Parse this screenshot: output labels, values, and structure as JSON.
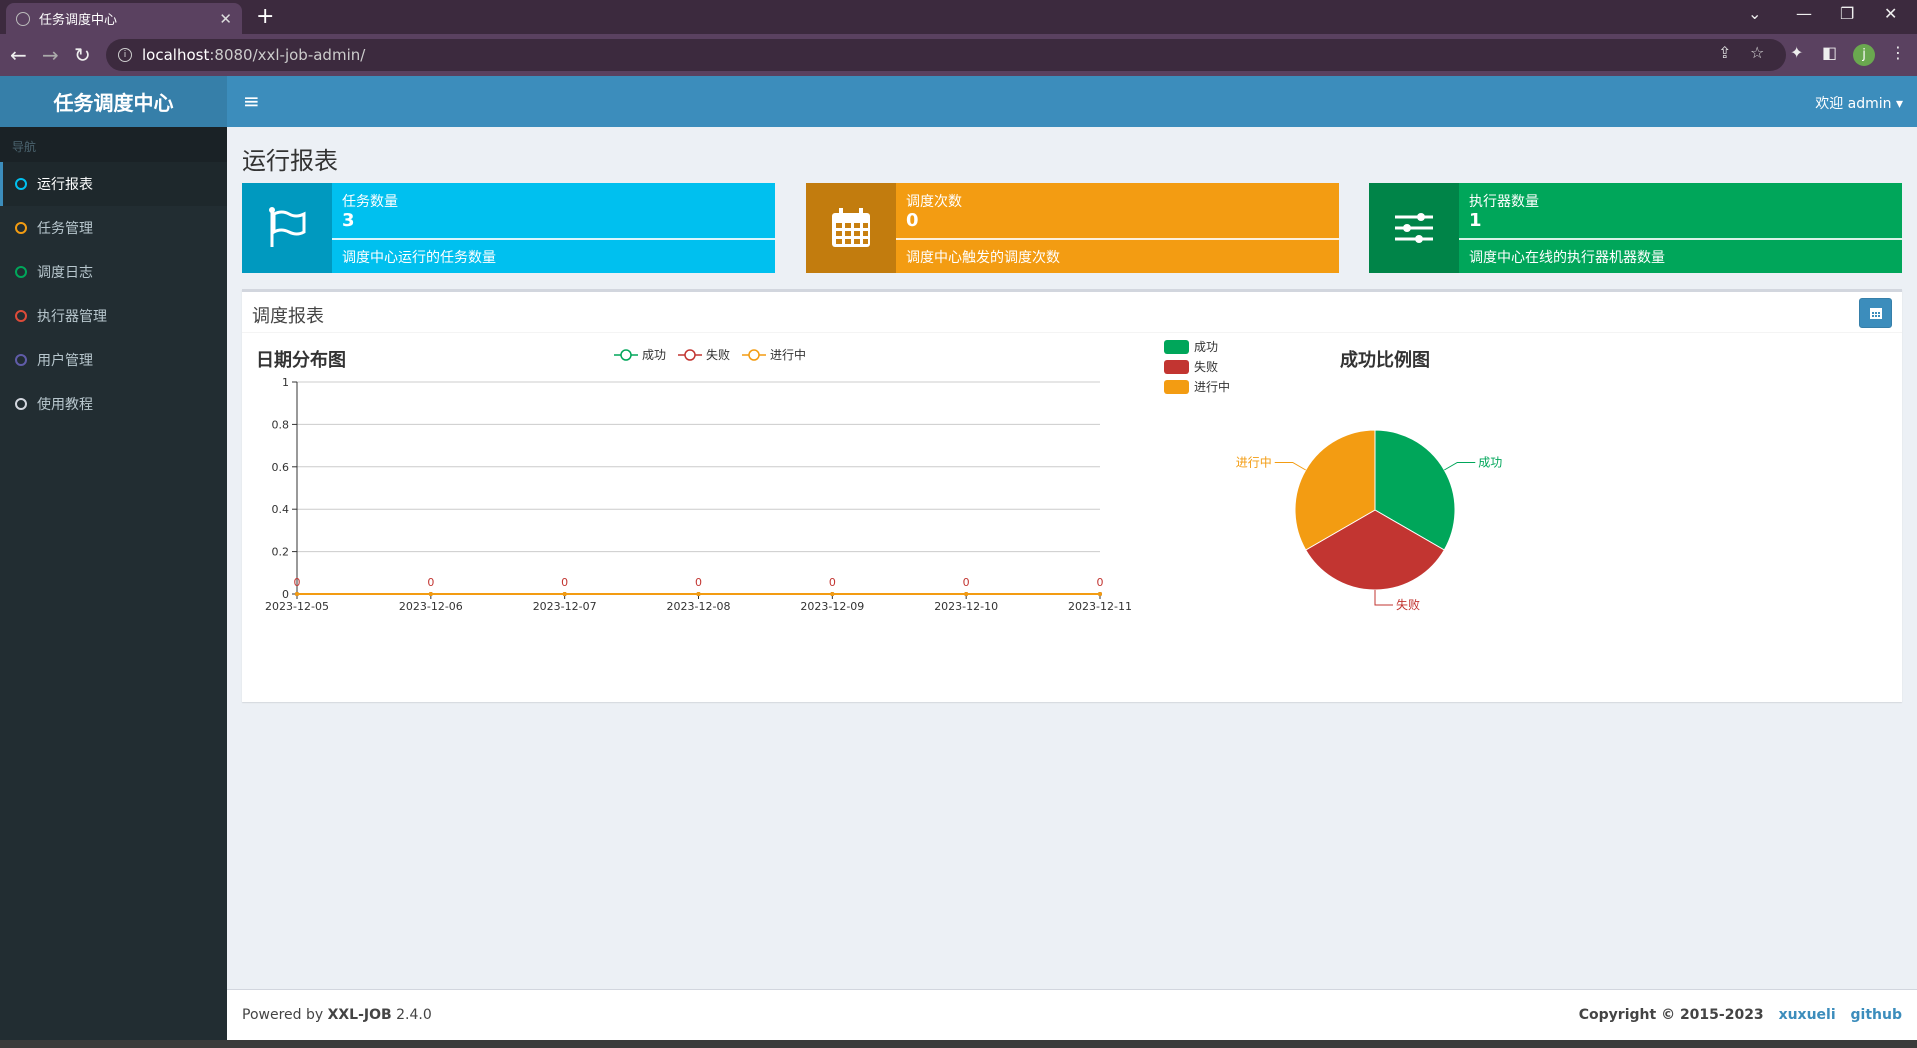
{
  "browser": {
    "tab_title": "任务调度中心",
    "url_host": "localhost",
    "url_path": ":8080/xxl-job-admin/",
    "profile_initial": "j"
  },
  "app": {
    "logo": "任务调度中心",
    "user_menu": "欢迎 admin ▾"
  },
  "sidebar": {
    "header": "导航",
    "items": [
      {
        "label": "运行报表",
        "color": "#00c0ef",
        "active": true
      },
      {
        "label": "任务管理",
        "color": "#f39c12"
      },
      {
        "label": "调度日志",
        "color": "#00a65a"
      },
      {
        "label": "执行器管理",
        "color": "#dd4b39"
      },
      {
        "label": "用户管理",
        "color": "#605ca8"
      },
      {
        "label": "使用教程",
        "color": "#d2d6de"
      }
    ]
  },
  "page_title": "运行报表",
  "info_boxes": [
    {
      "title": "任务数量",
      "value": "3",
      "desc": "调度中心运行的任务数量",
      "color": "#00c0ef",
      "icon": "flag-icon"
    },
    {
      "title": "调度次数",
      "value": "0",
      "desc": "调度中心触发的调度次数",
      "color": "#f39c12",
      "icon": "calendar-icon"
    },
    {
      "title": "执行器数量",
      "value": "1",
      "desc": "调度中心在线的执行器机器数量",
      "color": "#00a65a",
      "icon": "sliders-icon"
    }
  ],
  "report": {
    "title": "调度报表",
    "line_chart_title": "日期分布图",
    "pie_chart_title": "成功比例图"
  },
  "chart_data": [
    {
      "type": "line",
      "title": "日期分布图",
      "x": [
        "2023-12-05",
        "2023-12-06",
        "2023-12-07",
        "2023-12-08",
        "2023-12-09",
        "2023-12-10",
        "2023-12-11"
      ],
      "yticks": [
        "0",
        "0.2",
        "0.4",
        "0.6",
        "0.8",
        "1"
      ],
      "ylim": [
        0,
        1
      ],
      "grid": true,
      "legend_position": "top",
      "series": [
        {
          "name": "成功",
          "values": [
            0,
            0,
            0,
            0,
            0,
            0,
            0
          ],
          "color": "#00a65a"
        },
        {
          "name": "失败",
          "values": [
            0,
            0,
            0,
            0,
            0,
            0,
            0
          ],
          "color": "#c23531"
        },
        {
          "name": "进行中",
          "values": [
            0,
            0,
            0,
            0,
            0,
            0,
            0
          ],
          "color": "#f39c12"
        }
      ],
      "data_labels": [
        "0",
        "0",
        "0",
        "0",
        "0",
        "0",
        "0"
      ]
    },
    {
      "type": "pie",
      "title": "成功比例图",
      "legend_position": "top-left",
      "slices": [
        {
          "name": "成功",
          "value": 1,
          "color": "#00a65a"
        },
        {
          "name": "失败",
          "value": 1,
          "color": "#c23531"
        },
        {
          "name": "进行中",
          "value": 1,
          "color": "#f39c12"
        }
      ]
    }
  ],
  "footer": {
    "powered_prefix": "Powered by ",
    "powered_name": "XXL-JOB",
    "version": " 2.4.0",
    "copyright": "Copyright © 2015-2023",
    "link1": "xuxueli",
    "link2": "github"
  }
}
